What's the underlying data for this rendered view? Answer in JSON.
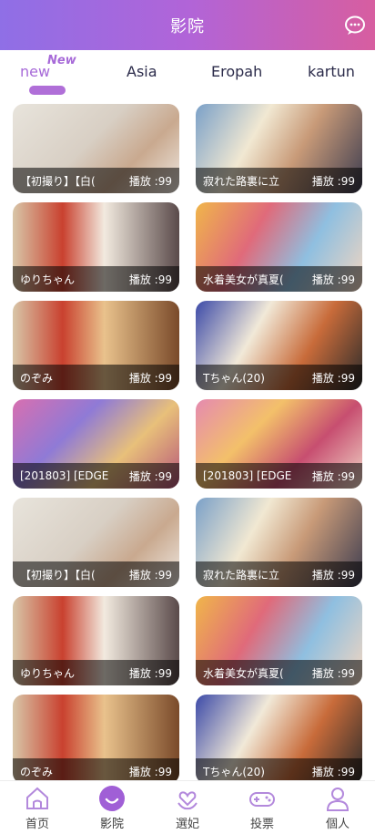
{
  "header": {
    "title": "影院"
  },
  "tabs": [
    {
      "label": "new",
      "badge": "New"
    },
    {
      "label": "Asia"
    },
    {
      "label": "Eropah"
    },
    {
      "label": "kartun"
    }
  ],
  "cards": [
    {
      "title": "【初撮り】【白(",
      "play": "播放 :99"
    },
    {
      "title": "寂れた路裏に立",
      "play": "播放 :99"
    },
    {
      "title": "ゆりちゃん",
      "play": "播放 :99"
    },
    {
      "title": "水着美女が真夏(",
      "play": "播放 :99"
    },
    {
      "title": "のぞみ",
      "play": "播放 :99"
    },
    {
      "title": "Tちゃん(20)",
      "play": "播放 :99"
    },
    {
      "title": "[201803] [EDGE",
      "play": "播放 :99"
    },
    {
      "title": "[201803] [EDGE",
      "play": "播放 :99"
    },
    {
      "title": "【初撮り】【白(",
      "play": "播放 :99"
    },
    {
      "title": "寂れた路裏に立",
      "play": "播放 :99"
    },
    {
      "title": "ゆりちゃん",
      "play": "播放 :99"
    },
    {
      "title": "水着美女が真夏(",
      "play": "播放 :99"
    },
    {
      "title": "のぞみ",
      "play": "播放 :99"
    },
    {
      "title": "Tちゃん(20)",
      "play": "播放 :99"
    }
  ],
  "nav": [
    {
      "label": "首页",
      "icon": "home-icon"
    },
    {
      "label": "影院",
      "icon": "smile-icon"
    },
    {
      "label": "選妃",
      "icon": "heart-hand-icon"
    },
    {
      "label": "投票",
      "icon": "gamepad-icon"
    },
    {
      "label": "個人",
      "icon": "user-icon"
    }
  ],
  "colors": {
    "accent": "#a76ad8",
    "header_start": "#8f6fe6",
    "header_end": "#d75ea0"
  }
}
